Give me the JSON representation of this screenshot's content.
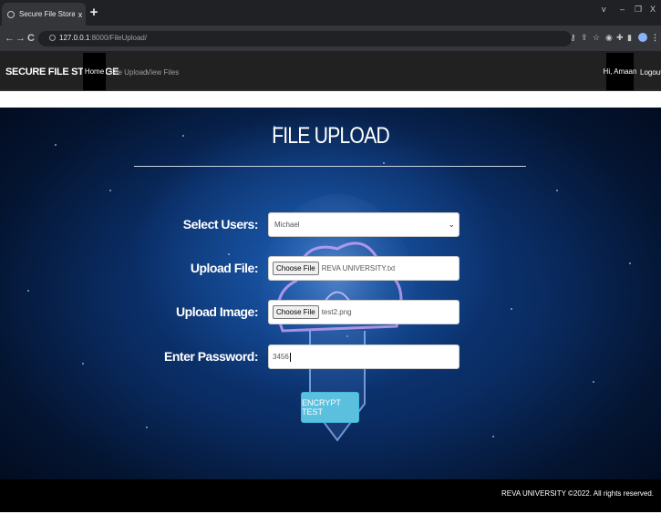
{
  "browser": {
    "tab_title": "Secure File Storage",
    "tab_close": "x",
    "new_tab": "+",
    "window_controls": {
      "dropdown": "v",
      "minimize": "–",
      "restore": "❐",
      "close": "X"
    },
    "nav": {
      "back": "←",
      "forward": "→",
      "reload": "C"
    },
    "url_host": "127.0.0.1",
    "url_rest": ":8000/FileUpload/",
    "ext_icons": [
      "key-icon",
      "share-icon",
      "star-icon",
      "extension-icon",
      "puzzle-icon",
      "sidebar-icon",
      "profile-icon",
      "menu-icon"
    ]
  },
  "navbar": {
    "brand": "SECURE FILE STORAGE",
    "links": {
      "home": "Home",
      "file_upload": "File Upload",
      "view_files": "View Files"
    },
    "user": "Hi, Amaan",
    "logout": "Logout"
  },
  "main": {
    "title": "FILE UPLOAD",
    "form": {
      "select_users_label": "Select Users:",
      "select_users_value": "Michael",
      "select_chevron": "⌄",
      "upload_file_label": "Upload File:",
      "upload_file_button": "Choose File",
      "upload_file_name": "REVA UNIVERSITY.txt",
      "upload_image_label": "Upload Image:",
      "upload_image_button": "Choose File",
      "upload_image_name": "test2.png",
      "password_label": "Enter Password:",
      "password_value": "3456",
      "submit": "ENCRYPT TEST"
    }
  },
  "footer": {
    "text": "REVA UNIVERSITY ©2022. All rights reserved."
  }
}
